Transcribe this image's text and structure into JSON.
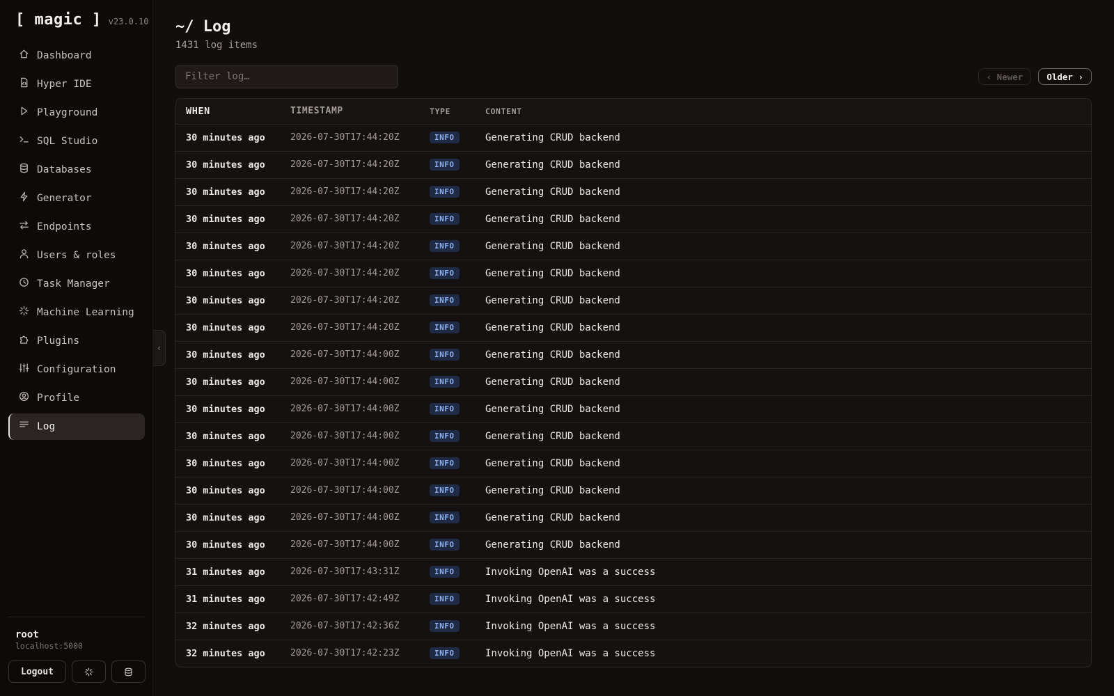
{
  "app": {
    "name": "[ magic ]",
    "version": "v23.0.10"
  },
  "sidebar": {
    "items": [
      {
        "label": "Dashboard",
        "icon": "home-icon"
      },
      {
        "label": "Hyper IDE",
        "icon": "code-file-icon"
      },
      {
        "label": "Playground",
        "icon": "play-icon"
      },
      {
        "label": "SQL Studio",
        "icon": "terminal-icon"
      },
      {
        "label": "Databases",
        "icon": "database-icon"
      },
      {
        "label": "Generator",
        "icon": "bolt-icon"
      },
      {
        "label": "Endpoints",
        "icon": "arrows-icon"
      },
      {
        "label": "Users & roles",
        "icon": "user-icon"
      },
      {
        "label": "Task Manager",
        "icon": "clock-icon"
      },
      {
        "label": "Machine Learning",
        "icon": "spark-icon"
      },
      {
        "label": "Plugins",
        "icon": "puzzle-icon"
      },
      {
        "label": "Configuration",
        "icon": "sliders-icon"
      },
      {
        "label": "Profile",
        "icon": "user-circle-icon"
      },
      {
        "label": "Log",
        "icon": "lines-icon",
        "active": true
      }
    ],
    "user": {
      "name": "root",
      "host": "localhost:5000"
    },
    "logout_label": "Logout"
  },
  "main": {
    "title": "~/ Log",
    "subtitle": "1431 log items",
    "filter_placeholder": "Filter log…",
    "newer_label": "‹ Newer",
    "older_label": "Older ›",
    "columns": [
      "WHEN",
      "TIMESTAMP",
      "TYPE",
      "CONTENT"
    ],
    "rows": [
      {
        "when": "30 minutes ago",
        "timestamp": "2026-07-30T17:44:20Z",
        "type": "INFO",
        "content": "Generating CRUD backend"
      },
      {
        "when": "30 minutes ago",
        "timestamp": "2026-07-30T17:44:20Z",
        "type": "INFO",
        "content": "Generating CRUD backend"
      },
      {
        "when": "30 minutes ago",
        "timestamp": "2026-07-30T17:44:20Z",
        "type": "INFO",
        "content": "Generating CRUD backend"
      },
      {
        "when": "30 minutes ago",
        "timestamp": "2026-07-30T17:44:20Z",
        "type": "INFO",
        "content": "Generating CRUD backend"
      },
      {
        "when": "30 minutes ago",
        "timestamp": "2026-07-30T17:44:20Z",
        "type": "INFO",
        "content": "Generating CRUD backend"
      },
      {
        "when": "30 minutes ago",
        "timestamp": "2026-07-30T17:44:20Z",
        "type": "INFO",
        "content": "Generating CRUD backend"
      },
      {
        "when": "30 minutes ago",
        "timestamp": "2026-07-30T17:44:20Z",
        "type": "INFO",
        "content": "Generating CRUD backend"
      },
      {
        "when": "30 minutes ago",
        "timestamp": "2026-07-30T17:44:20Z",
        "type": "INFO",
        "content": "Generating CRUD backend"
      },
      {
        "when": "30 minutes ago",
        "timestamp": "2026-07-30T17:44:00Z",
        "type": "INFO",
        "content": "Generating CRUD backend"
      },
      {
        "when": "30 minutes ago",
        "timestamp": "2026-07-30T17:44:00Z",
        "type": "INFO",
        "content": "Generating CRUD backend"
      },
      {
        "when": "30 minutes ago",
        "timestamp": "2026-07-30T17:44:00Z",
        "type": "INFO",
        "content": "Generating CRUD backend"
      },
      {
        "when": "30 minutes ago",
        "timestamp": "2026-07-30T17:44:00Z",
        "type": "INFO",
        "content": "Generating CRUD backend"
      },
      {
        "when": "30 minutes ago",
        "timestamp": "2026-07-30T17:44:00Z",
        "type": "INFO",
        "content": "Generating CRUD backend"
      },
      {
        "when": "30 minutes ago",
        "timestamp": "2026-07-30T17:44:00Z",
        "type": "INFO",
        "content": "Generating CRUD backend"
      },
      {
        "when": "30 minutes ago",
        "timestamp": "2026-07-30T17:44:00Z",
        "type": "INFO",
        "content": "Generating CRUD backend"
      },
      {
        "when": "30 minutes ago",
        "timestamp": "2026-07-30T17:44:00Z",
        "type": "INFO",
        "content": "Generating CRUD backend"
      },
      {
        "when": "31 minutes ago",
        "timestamp": "2026-07-30T17:43:31Z",
        "type": "INFO",
        "content": "Invoking OpenAI was a success"
      },
      {
        "when": "31 minutes ago",
        "timestamp": "2026-07-30T17:42:49Z",
        "type": "INFO",
        "content": "Invoking OpenAI was a success"
      },
      {
        "when": "32 minutes ago",
        "timestamp": "2026-07-30T17:42:36Z",
        "type": "INFO",
        "content": "Invoking OpenAI was a success"
      },
      {
        "when": "32 minutes ago",
        "timestamp": "2026-07-30T17:42:23Z",
        "type": "INFO",
        "content": "Invoking OpenAI was a success"
      }
    ]
  }
}
